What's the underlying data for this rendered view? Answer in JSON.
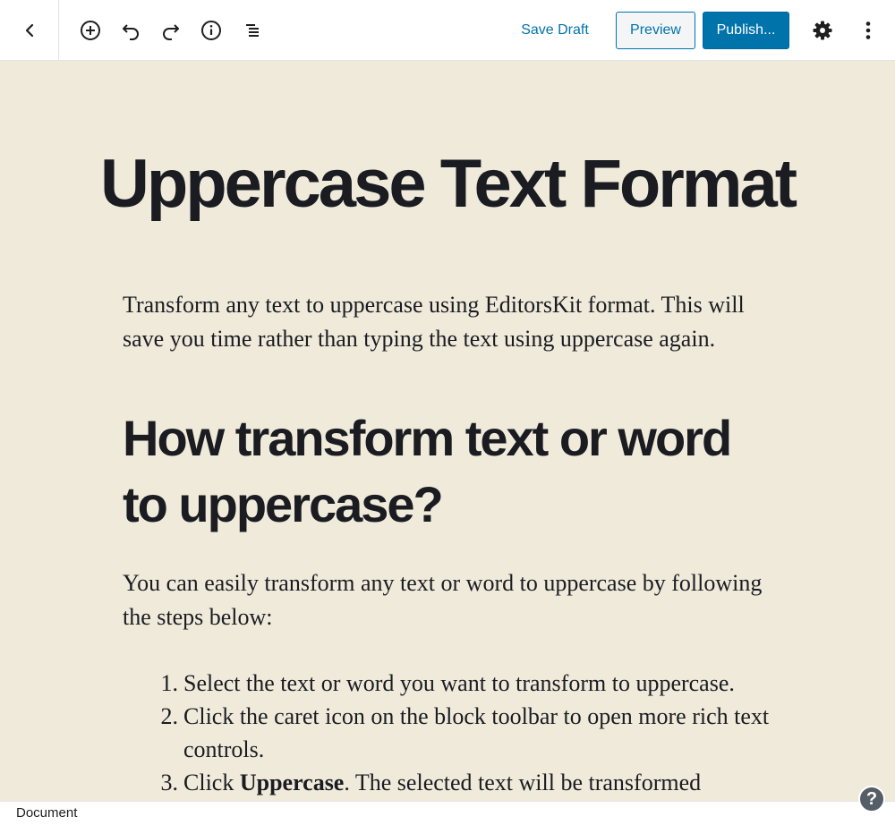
{
  "toolbar": {
    "save_draft": "Save Draft",
    "preview": "Preview",
    "publish": "Publish..."
  },
  "post": {
    "title": "Uppercase Text Format",
    "intro": "Transform any text to uppercase using EditorsKit format. This will save you time rather than typing the text using uppercase again.",
    "heading": "How transform text or word to uppercase?",
    "lead": "You can easily transform any text or word to uppercase by following the steps below:",
    "steps": [
      {
        "num": "1.",
        "text": "Select the text or word you want to transform to uppercase."
      },
      {
        "num": "2.",
        "text": "Click the caret icon on the block toolbar to open more rich text controls."
      },
      {
        "num": "3.",
        "bold": "Uppercase",
        "rest": ". The selected text will be transformed",
        "prefix": "Click "
      }
    ]
  },
  "footer": {
    "label": "Document",
    "help": "?"
  },
  "colors": {
    "accent": "#0073aa",
    "canvas_bg": "#f0eadb",
    "text": "#1a1c21"
  }
}
